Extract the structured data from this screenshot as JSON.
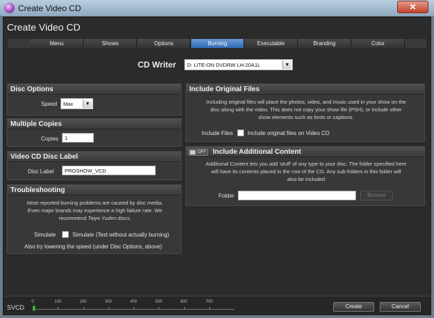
{
  "window": {
    "title": "Create Video CD",
    "close_glyph": "✕"
  },
  "header": {
    "title": "Create Video CD"
  },
  "tabs": [
    {
      "label": "Menu"
    },
    {
      "label": "Shows"
    },
    {
      "label": "Options"
    },
    {
      "label": "Burning",
      "active": true
    },
    {
      "label": "Executable"
    },
    {
      "label": "Branding"
    },
    {
      "label": "Color"
    }
  ],
  "cd_writer": {
    "label": "CD Writer",
    "value": "D: LITE-ON DVDRW LH-20A1L"
  },
  "disc_options": {
    "title": "Disc Options",
    "speed_label": "Speed",
    "speed_value": "Max"
  },
  "multiple_copies": {
    "title": "Multiple Copies",
    "copies_label": "Copies",
    "copies_value": "1"
  },
  "disc_label": {
    "title": "Video CD Disc Label",
    "label": "Disc Label",
    "value": "PROSHOW_VCD"
  },
  "troubleshooting": {
    "title": "Troubleshooting",
    "line1": "Most reported burning problems are caused by disc media.",
    "line2": "Even major brands may experience a high failure rate. We",
    "line3_pre": "recommend ",
    "line3_em": "Taiyo Yuden",
    "line3_post": " discs.",
    "simulate_label": "Simulate",
    "simulate_check_label": "Simulate (Test without actually burning)",
    "note": "Also try lowering the speed (under Disc Options, above)"
  },
  "include_original": {
    "title": "Include Original Files",
    "line1": "Including original files will place the photos, video, and music used in your show on the",
    "line2": "disc along with the video. This does not copy your show file (PSH), or include other",
    "line3": "show elements such as fonts or captions.",
    "field_label": "Include Files",
    "check_label": "Include original files on Video CD"
  },
  "additional_content": {
    "title": "Include Additional Content",
    "toggle_label": "OFF",
    "line1": "Additional Content lets you add 'stuff' of any type to your disc. The folder specified here",
    "line2": "will have its contents placed in the root of the CD. Any sub-folders in this folder will",
    "line3": "also be included",
    "folder_label": "Folder",
    "folder_value": "",
    "browse_label": "Browse"
  },
  "footer": {
    "svcd_label": "SVCD",
    "scale_max": 800,
    "scale_ticks": [
      "0",
      "100",
      "200",
      "300",
      "400",
      "500",
      "600",
      "700"
    ],
    "used": 12,
    "create_label": "Create",
    "cancel_label": "Cancel"
  },
  "colors": {
    "accent_tab": "#3f78c0",
    "progress": "#38c83b"
  }
}
